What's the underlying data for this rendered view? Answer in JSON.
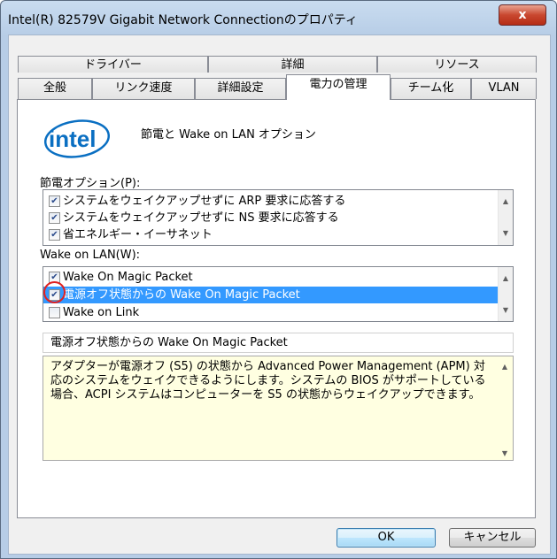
{
  "window": {
    "title": "Intel(R) 82579V Gigabit Network Connectionのプロパティ",
    "close_label": "x"
  },
  "tabs": {
    "top_row": [
      {
        "label": "ドライバー"
      },
      {
        "label": "詳細"
      },
      {
        "label": "リソース"
      }
    ],
    "bottom_row": [
      {
        "label": "全般"
      },
      {
        "label": "リンク速度"
      },
      {
        "label": "詳細設定"
      },
      {
        "label": "電力の管理",
        "active": true
      },
      {
        "label": "チーム化"
      },
      {
        "label": "VLAN"
      }
    ]
  },
  "header": {
    "logo_text": "intel",
    "heading": "節電と Wake on LAN オプション"
  },
  "power_options": {
    "label": "節電オプション(P):",
    "items": [
      {
        "label": "システムをウェイクアップせずに ARP 要求に応答する",
        "checked": true
      },
      {
        "label": "システムをウェイクアップせずに NS 要求に応答する",
        "checked": true
      },
      {
        "label": "省エネルギー・イーサネット",
        "checked": true
      }
    ]
  },
  "wol": {
    "label": "Wake on LAN(W):",
    "items": [
      {
        "label": "Wake On Magic Packet",
        "checked": true
      },
      {
        "label": "電源オフ状態からの Wake On Magic Packet",
        "checked": true,
        "selected": true
      },
      {
        "label": "Wake on Link",
        "checked": false
      }
    ]
  },
  "description": {
    "title": "電源オフ状態からの Wake On Magic Packet",
    "text": "アダプターが電源オフ (S5) の状態から Advanced Power Management (APM) 対応のシステムをウェイクできるようにします。システムの BIOS がサポートしている場合、ACPI システムはコンピューターを S5 の状態からウェイクアップできます。"
  },
  "buttons": {
    "ok": "OK",
    "cancel": "キャンセル"
  },
  "colors": {
    "selection": "#3399ff",
    "description_bg": "#ffffe1",
    "highlight_circle": "#e02020"
  }
}
